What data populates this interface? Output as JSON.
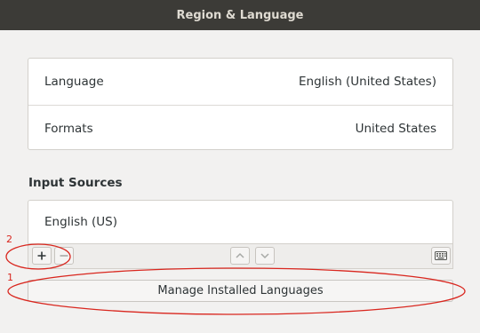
{
  "window": {
    "title": "Region & Language"
  },
  "settings": {
    "rows": [
      {
        "label": "Language",
        "value": "English (United States)"
      },
      {
        "label": "Formats",
        "value": "United States"
      }
    ]
  },
  "input_sources": {
    "heading": "Input Sources",
    "items": [
      "English (US)"
    ],
    "toolbar": {
      "add_icon": "plus-icon",
      "remove_icon": "minus-icon",
      "up_icon": "chevron-up-icon",
      "down_icon": "chevron-down-icon",
      "keyboard_icon": "keyboard-icon"
    }
  },
  "manage_button": {
    "label": "Manage Installed Languages"
  },
  "annotations": {
    "color": "#d9261e",
    "markers": [
      "1",
      "2"
    ]
  }
}
